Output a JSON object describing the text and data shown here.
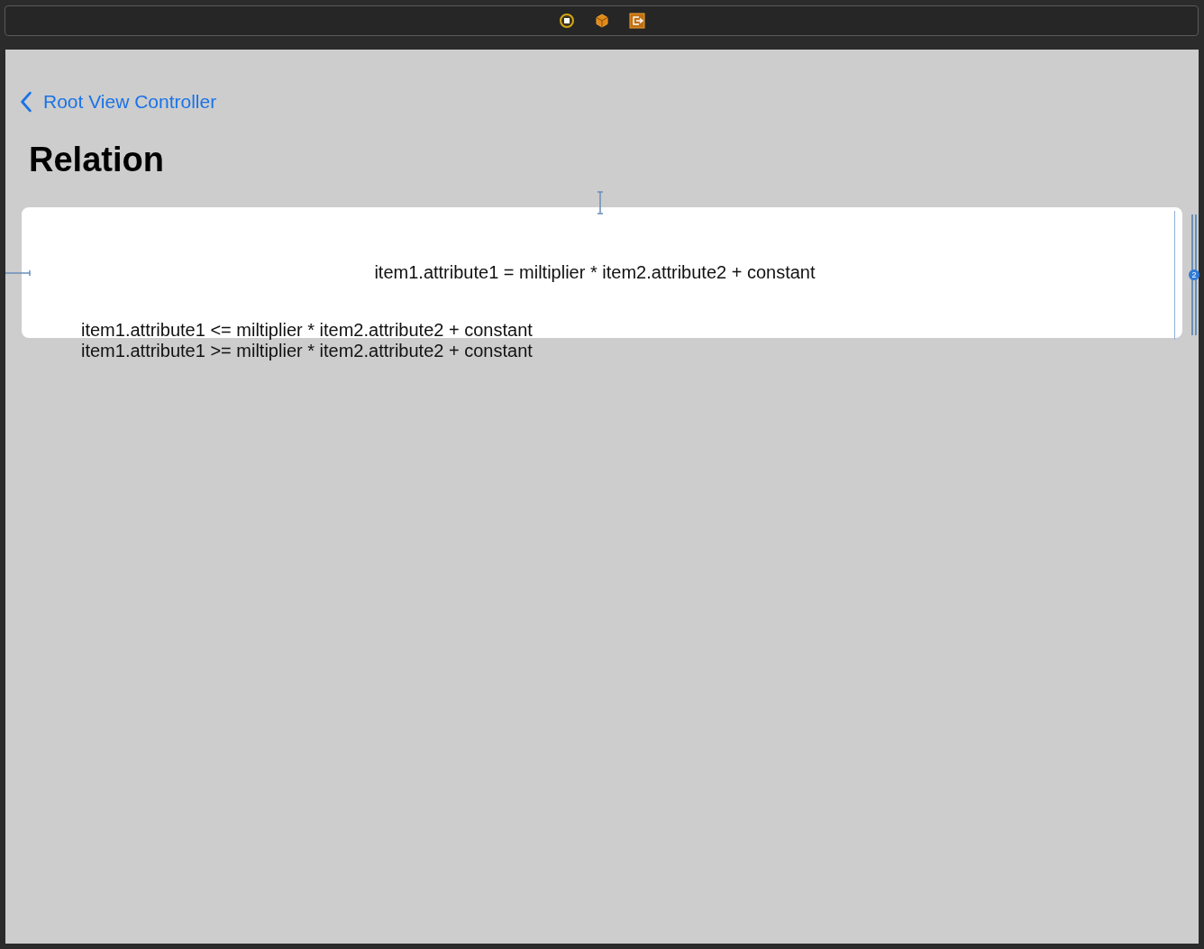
{
  "navigation": {
    "back_label": "Root View Controller",
    "title": "Relation"
  },
  "card": {
    "text": "item1.attribute1 = miltiplier * item2.attribute2 + constant",
    "constraint_badge": "2"
  },
  "lines": [
    "item1.attribute1 <= miltiplier * item2.attribute2 + constant",
    "item1.attribute1 >= miltiplier * item2.attribute2 + constant"
  ]
}
